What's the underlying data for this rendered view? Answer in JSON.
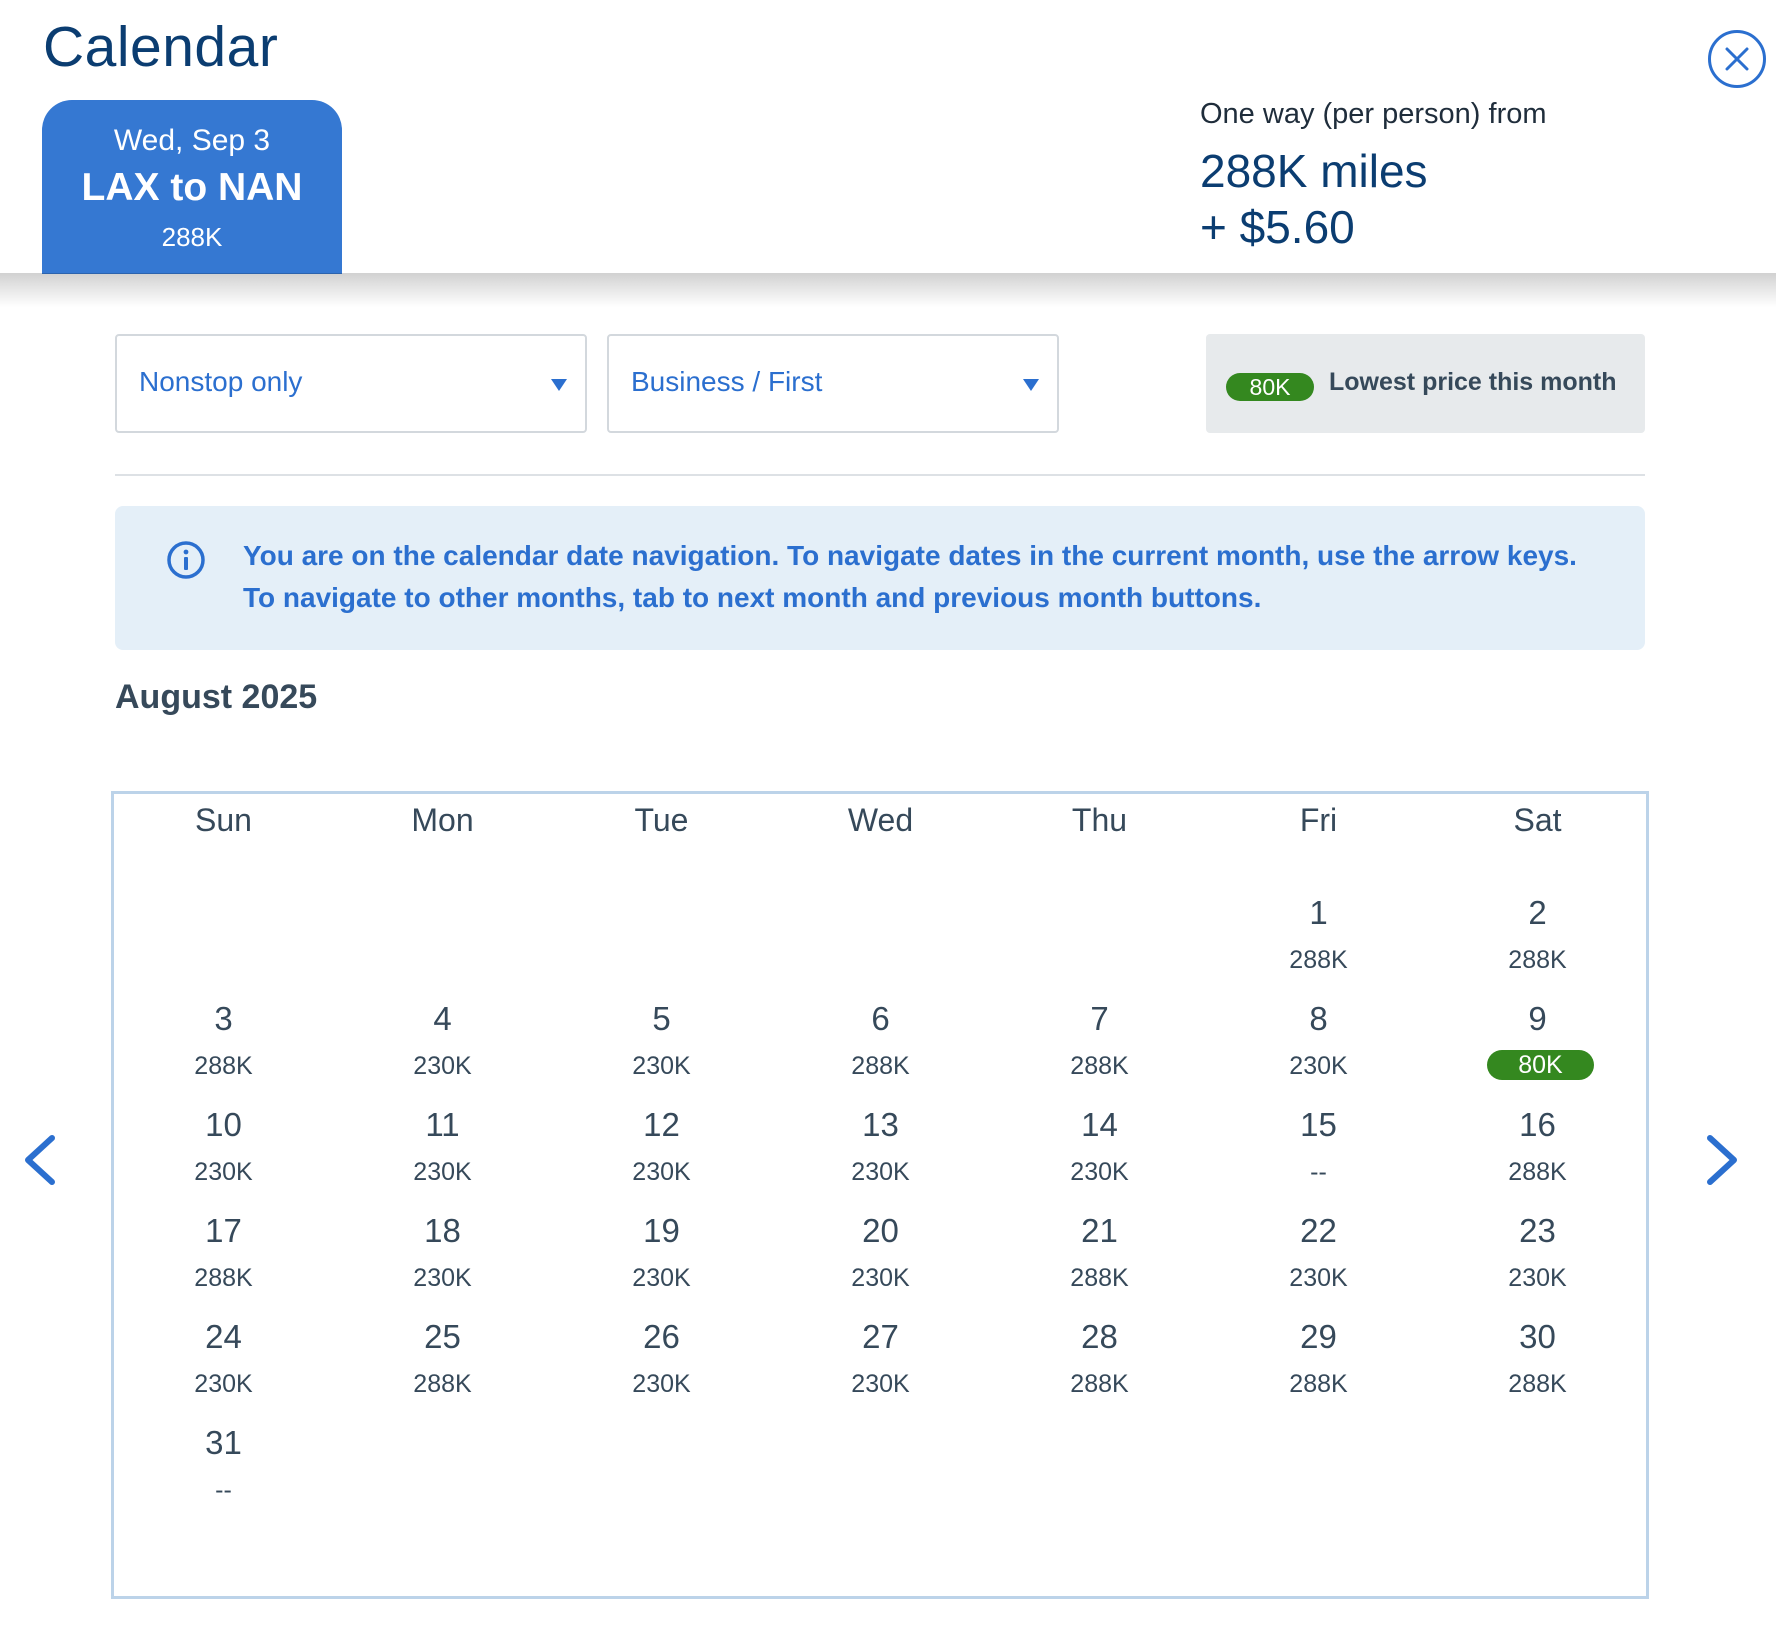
{
  "header": {
    "title": "Calendar",
    "flight_tab": {
      "date": "Wed, Sep 3",
      "route": "LAX to NAN",
      "price": "288K"
    },
    "fare": {
      "label": "One way (per person) from",
      "miles": "288K miles",
      "fee": "+ $5.60"
    }
  },
  "filters": {
    "stops": {
      "value": "Nonstop only"
    },
    "cabin": {
      "value": "Business / First"
    },
    "lowest": {
      "pill": "80K",
      "text": "Lowest price this month"
    }
  },
  "info": {
    "message": "You are on the calendar date navigation. To navigate dates in the current month, use the arrow keys. To navigate to other months, tab to next month and previous month buttons."
  },
  "calendar": {
    "month": "August 2025",
    "weekdays": [
      "Sun",
      "Mon",
      "Tue",
      "Wed",
      "Thu",
      "Fri",
      "Sat"
    ],
    "first_weekday_index": 5,
    "days": [
      {
        "day": "1",
        "price": "288K"
      },
      {
        "day": "2",
        "price": "288K"
      },
      {
        "day": "3",
        "price": "288K"
      },
      {
        "day": "4",
        "price": "230K"
      },
      {
        "day": "5",
        "price": "230K"
      },
      {
        "day": "6",
        "price": "288K"
      },
      {
        "day": "7",
        "price": "288K"
      },
      {
        "day": "8",
        "price": "230K"
      },
      {
        "day": "9",
        "price": "80K",
        "lowest": true
      },
      {
        "day": "10",
        "price": "230K"
      },
      {
        "day": "11",
        "price": "230K"
      },
      {
        "day": "12",
        "price": "230K"
      },
      {
        "day": "13",
        "price": "230K"
      },
      {
        "day": "14",
        "price": "230K"
      },
      {
        "day": "15",
        "price": "--"
      },
      {
        "day": "16",
        "price": "288K"
      },
      {
        "day": "17",
        "price": "288K"
      },
      {
        "day": "18",
        "price": "230K"
      },
      {
        "day": "19",
        "price": "230K"
      },
      {
        "day": "20",
        "price": "230K"
      },
      {
        "day": "21",
        "price": "288K"
      },
      {
        "day": "22",
        "price": "230K"
      },
      {
        "day": "23",
        "price": "230K"
      },
      {
        "day": "24",
        "price": "230K"
      },
      {
        "day": "25",
        "price": "288K"
      },
      {
        "day": "26",
        "price": "230K"
      },
      {
        "day": "27",
        "price": "230K"
      },
      {
        "day": "28",
        "price": "288K"
      },
      {
        "day": "29",
        "price": "288K"
      },
      {
        "day": "30",
        "price": "288K"
      },
      {
        "day": "31",
        "price": "--"
      }
    ]
  },
  "icons": {
    "close": "close-circle-icon",
    "info": "info-circle-icon",
    "prev": "chevron-left-icon",
    "next": "chevron-right-icon",
    "dropdown": "caret-down-icon"
  },
  "colors": {
    "primary": "#2b6fcf",
    "tab": "#3578d2",
    "navy": "#0b3d71",
    "lowest_green": "#34881f",
    "info_bg": "#e4eff8",
    "text": "#36495a"
  }
}
